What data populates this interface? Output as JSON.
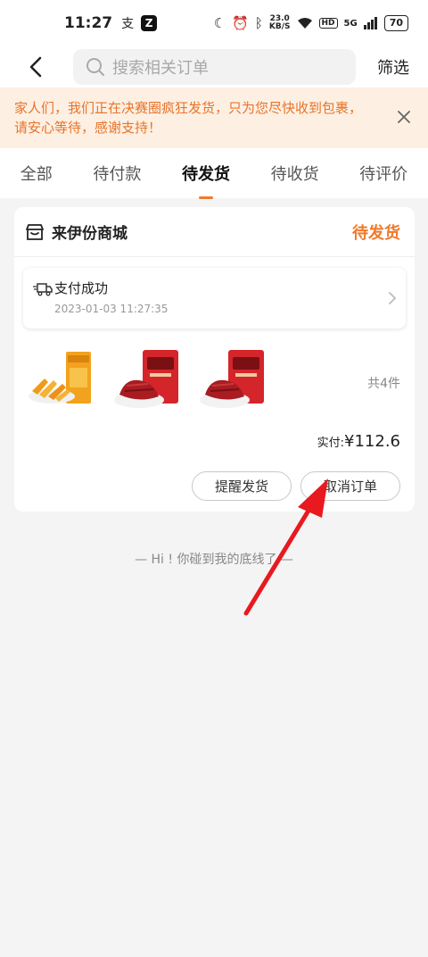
{
  "status_bar": {
    "time": "11:27",
    "speed_value": "23.0",
    "speed_unit": "KB/S",
    "network": "5G",
    "hd": "HD",
    "battery": "70"
  },
  "header": {
    "search_placeholder": "搜索相关订单",
    "filter_label": "筛选"
  },
  "notice": {
    "text": "家人们，我们正在决赛圈疯狂发货，只为您尽快收到包裹，请安心等待，感谢支持！"
  },
  "tabs": [
    {
      "label": "全部"
    },
    {
      "label": "待付款"
    },
    {
      "label": "待发货",
      "active": true
    },
    {
      "label": "待收货"
    },
    {
      "label": "待评价"
    }
  ],
  "order": {
    "shop_name": "来伊份商城",
    "status": "待发货",
    "payment_status": "支付成功",
    "payment_time": "2023-01-03 11:27:35",
    "total_items": "共4件",
    "paid_label": "实付:",
    "paid_amount": "¥112.6",
    "actions": {
      "remind": "提醒发货",
      "cancel": "取消订单"
    }
  },
  "footer_note": "— Hi ! 你碰到我的底线了 —",
  "colors": {
    "accent": "#f07a2c",
    "notice_bg": "#fdf0e3",
    "page_bg": "#f4f4f4",
    "annotation": "#e8191f"
  }
}
